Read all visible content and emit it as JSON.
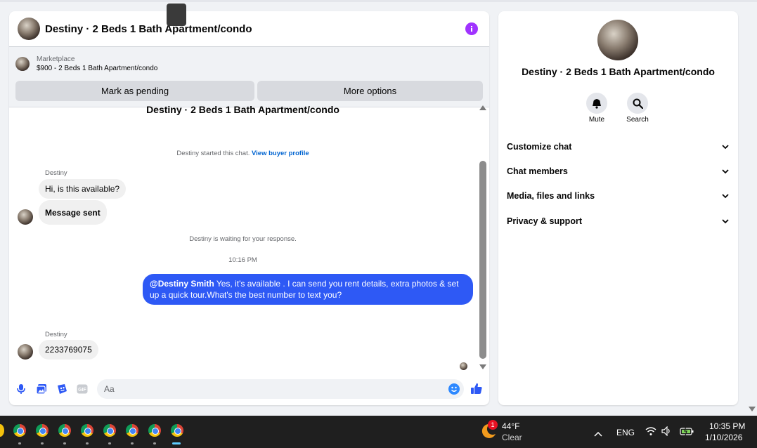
{
  "chat": {
    "title": "Destiny · 2 Beds 1 Bath Apartment/condo",
    "marketplace_label": "Marketplace",
    "listing": "$900 - 2 Beds 1 Bath Apartment/condo",
    "mark_pending": "Mark as pending",
    "more_options": "More options",
    "conversation_title": "Destiny · 2 Beds 1 Bath Apartment/condo",
    "started_text": "Destiny started this chat.",
    "view_profile": "View buyer profile",
    "sender_1": "Destiny",
    "msg_1": "Hi, is this available?",
    "msg_2": "Message sent",
    "waiting_text": "Destiny is waiting for your response.",
    "timestamp": "10:16 PM",
    "out_mention": "@Destiny Smith",
    "out_text": " Yes, it's available .  I can send you rent details, extra photos & set up a quick tour.What's the best number to text you?",
    "sender_2": "Destiny",
    "msg_3": "2233769075",
    "input_placeholder": "Aa"
  },
  "side": {
    "title": "Destiny · 2 Beds 1 Bath Apartment/condo",
    "mute": "Mute",
    "search": "Search",
    "sections": [
      "Customize chat",
      "Chat members",
      "Media, files and links",
      "Privacy & support"
    ]
  },
  "taskbar": {
    "weather_badge": "1",
    "temp": "44°F",
    "condition": "Clear",
    "lang": "ENG",
    "time": "10:35 PM",
    "date": "1/10/2026"
  },
  "colors": {
    "accent": "#2e59f5",
    "info": "#a033ff",
    "link": "#0064d1",
    "taskbar": "#1f1f1f"
  }
}
